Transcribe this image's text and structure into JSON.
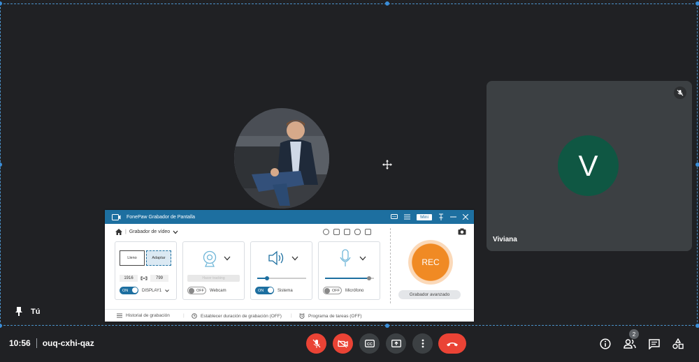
{
  "meeting": {
    "time": "10:56",
    "code": "ouq-cxhi-qaz",
    "participant_count": "2"
  },
  "self_tile": {
    "label": "Tú"
  },
  "participant": {
    "initial": "V",
    "name": "Viviana",
    "avatar_color": "#0f5743"
  },
  "colors": {
    "background": "#202124",
    "tile": "#3c4043",
    "danger": "#ea4335",
    "fonepaw_blue": "#1d6fa0",
    "rec_orange": "#f08a24"
  },
  "controls": [
    {
      "name": "mic-off-icon",
      "style": "red"
    },
    {
      "name": "camera-off-icon",
      "style": "red"
    },
    {
      "name": "captions-icon",
      "style": "gray"
    },
    {
      "name": "present-screen-icon",
      "style": "gray"
    },
    {
      "name": "more-options-icon",
      "style": "gray"
    },
    {
      "name": "hang-up-icon",
      "style": "red"
    }
  ],
  "fonepaw": {
    "title": "FonePaw Grabador de Pantalla",
    "mini_label": "Mini",
    "mode": "Grabador de vídeo",
    "display": {
      "full_label": "Lleno",
      "fit_label": "Adaptar",
      "width": "1916",
      "height": "799",
      "toggle": "ON",
      "monitor": "DISPLAY1"
    },
    "webcam": {
      "placeholder_label": "Hacer tracking",
      "toggle": "OFF",
      "label": "Webcam"
    },
    "system": {
      "toggle": "ON",
      "label": "Sistema",
      "level": 0.2
    },
    "mic": {
      "toggle": "OFF",
      "label": "Micrófono",
      "level": 0.9
    },
    "rec_label": "REC",
    "advanced_label": "Grabador avanzado",
    "footer": {
      "history": "Historial de grabación",
      "duration": "Establecer duración de grabación (OFF)",
      "schedule": "Programa de tareas (OFF)"
    }
  }
}
